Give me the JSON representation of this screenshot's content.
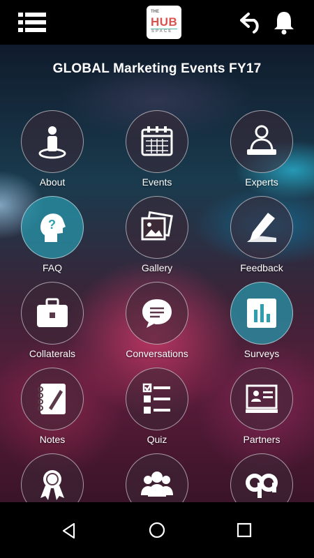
{
  "app": {
    "logo_text": {
      "top": "THE",
      "main": "HUB",
      "bottom": "SPACE"
    },
    "title": "GLOBAL Marketing Events FY17"
  },
  "toolbar": {
    "menu_icon": "menu-icon",
    "back_icon": "back-arrow-icon",
    "bell_icon": "bell-icon"
  },
  "tiles": [
    {
      "label": "About",
      "icon": "person-icon"
    },
    {
      "label": "Events",
      "icon": "calendar-icon"
    },
    {
      "label": "Experts",
      "icon": "expert-icon"
    },
    {
      "label": "FAQ",
      "icon": "head-question-icon"
    },
    {
      "label": "Gallery",
      "icon": "photos-icon"
    },
    {
      "label": "Feedback",
      "icon": "pen-hand-icon"
    },
    {
      "label": "Collaterals",
      "icon": "briefcase-icon"
    },
    {
      "label": "Conversations",
      "icon": "chat-bubble-icon"
    },
    {
      "label": "Surveys",
      "icon": "bar-chart-icon"
    },
    {
      "label": "Notes",
      "icon": "notebook-icon"
    },
    {
      "label": "Quiz",
      "icon": "checklist-icon"
    },
    {
      "label": "Partners",
      "icon": "presentation-board-icon"
    },
    {
      "label": "",
      "icon": "award-ribbon-icon"
    },
    {
      "label": "",
      "icon": "group-icon"
    },
    {
      "label": "",
      "icon": "qa-icon"
    }
  ],
  "colors": {
    "accent_teal": "#2f9fb0",
    "brand_red": "#d9534f",
    "topbar": "#000000"
  },
  "system_nav": {
    "back": "nav-back-icon",
    "home": "nav-home-icon",
    "recents": "nav-recents-icon"
  }
}
